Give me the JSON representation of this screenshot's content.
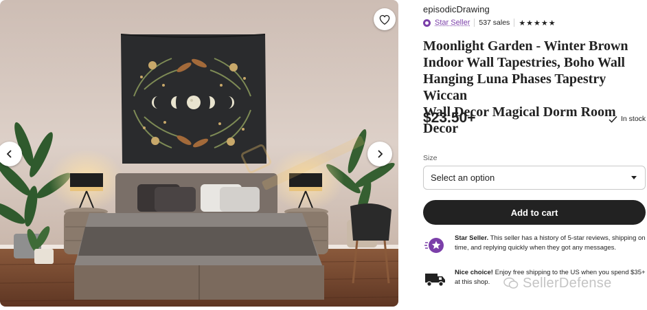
{
  "shop": {
    "name": "episodicDrawing",
    "badge_label": "Star Seller",
    "sales": "537 sales",
    "rating_stars": "★★★★★",
    "rating_value": 5
  },
  "product": {
    "title": "Moonlight Garden - Winter Brown\nIndoor Wall Tapestries, Boho Wall\nHanging Luna Phases Tapestry Wiccan\nWall Decor Magical Dorm Room Decor",
    "price": "$23.50+",
    "stock": "In stock"
  },
  "options": {
    "size_label": "Size",
    "size_selected": "Select an option"
  },
  "actions": {
    "add_to_cart": "Add to cart"
  },
  "perks": [
    {
      "title": "Star Seller.",
      "text": " This seller has a history of 5-star reviews, shipping on time, and replying quickly when they got any messages.",
      "icon": "star-seller-badge-icon"
    },
    {
      "title": "Nice choice!",
      "text": " Enjoy free shipping to the US when you spend $35+ at this shop.",
      "icon": "delivery-truck-icon"
    }
  ],
  "gallery": {
    "icons": {
      "favorite": "heart-icon",
      "prev": "chevron-left-icon",
      "next": "chevron-right-icon"
    }
  },
  "watermark": {
    "text": "SellerDefense"
  },
  "colors": {
    "badge_purple": "#7b3fa9",
    "button_dark": "#222222",
    "tapestry": "#2a2b2d",
    "wall": "#d6c8bf"
  }
}
